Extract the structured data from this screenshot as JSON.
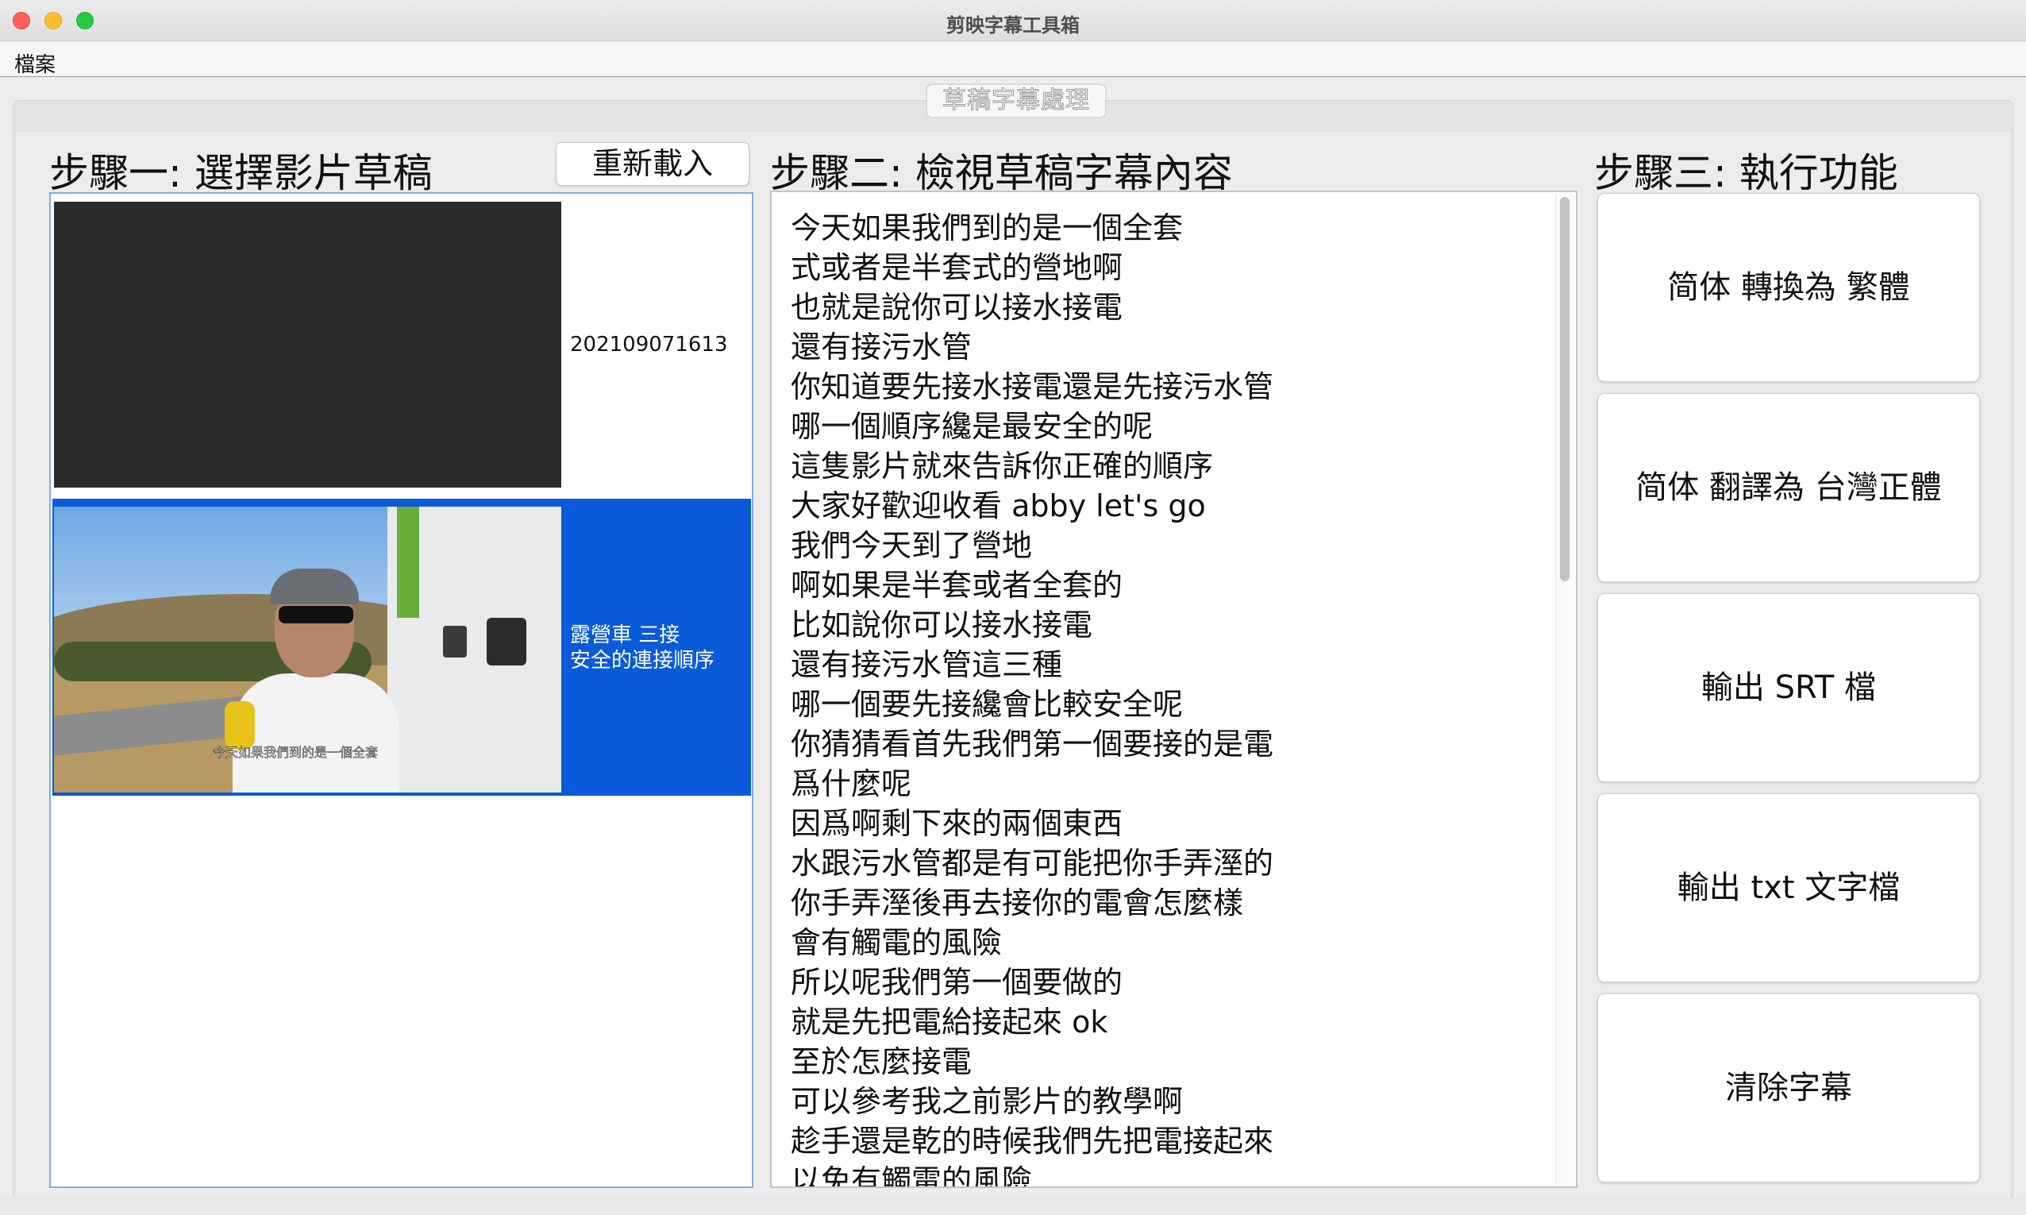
{
  "window": {
    "title": "剪映字幕工具箱"
  },
  "menu": {
    "file": "檔案"
  },
  "tabs": [
    {
      "label": "草稿字幕處理"
    }
  ],
  "step1": {
    "heading": "步驟一: 選擇影片草稿",
    "reload_label": "重新載入",
    "drafts": [
      {
        "title_lines": [
          "202109071613"
        ],
        "selected": false
      },
      {
        "title_lines": [
          "露營車 三接",
          "安全的連接順序"
        ],
        "selected": true,
        "thumbnail_caption": "今天如果我們到的是一個全套"
      }
    ]
  },
  "step2": {
    "heading": "步驟二: 檢視草稿字幕內容",
    "lines": [
      "今天如果我們到的是一個全套",
      "式或者是半套式的營地啊",
      "也就是說你可以接水接電",
      "還有接污水管",
      "你知道要先接水接電還是先接污水管",
      "哪一個順序纔是最安全的呢",
      "這隻影片就來告訴你正確的順序",
      "大家好歡迎收看 abby let's go",
      "我們今天到了營地",
      "啊如果是半套或者全套的",
      "比如說你可以接水接電",
      "還有接污水管這三種",
      "哪一個要先接纔會比較安全呢",
      "你猜猜看首先我們第一個要接的是電",
      "爲什麼呢",
      "因爲啊剩下來的兩個東西",
      "水跟污水管都是有可能把你手弄溼的",
      "你手弄溼後再去接你的電會怎麼樣",
      "會有觸電的風險",
      "所以呢我們第一個要做的",
      "就是先把電給接起來 ok",
      "至於怎麼接電",
      "可以參考我之前影片的教學啊",
      "趁手還是乾的時候我們先把電接起來",
      "以免有觸電的風險"
    ]
  },
  "step3": {
    "heading": "步驟三: 執行功能",
    "buttons": [
      {
        "label": "简体 轉換為 繁體"
      },
      {
        "label": "简体 翻譯為 台灣正體"
      },
      {
        "label": "輸出 SRT 檔"
      },
      {
        "label": "輸出 txt 文字檔"
      },
      {
        "label": "清除字幕"
      }
    ]
  },
  "colors": {
    "selection": "#0b5ad9",
    "list_border": "#7eaee8"
  }
}
